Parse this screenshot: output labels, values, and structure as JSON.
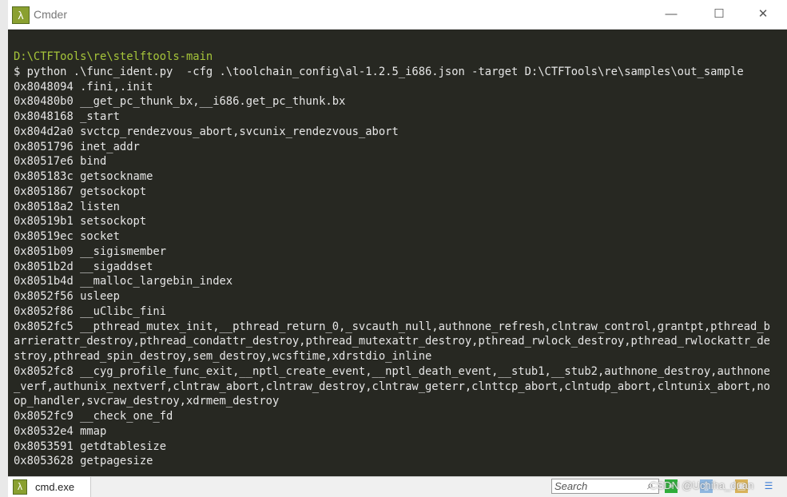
{
  "window": {
    "title": "Cmder",
    "minimize": "—",
    "maximize": "☐",
    "close": "✕"
  },
  "terminal": {
    "path": "D:\\CTFTools\\re\\stelftools-main",
    "lines": [
      "$ python .\\func_ident.py  -cfg .\\toolchain_config\\al-1.2.5_i686.json -target D:\\CTFTools\\re\\samples\\out_sample",
      "0x8048094 .fini,.init",
      "0x80480b0 __get_pc_thunk_bx,__i686.get_pc_thunk.bx",
      "0x8048168 _start",
      "0x804d2a0 svctcp_rendezvous_abort,svcunix_rendezvous_abort",
      "0x8051796 inet_addr",
      "0x80517e6 bind",
      "0x805183c getsockname",
      "0x8051867 getsockopt",
      "0x80518a2 listen",
      "0x80519b1 setsockopt",
      "0x80519ec socket",
      "0x8051b09 __sigismember",
      "0x8051b2d __sigaddset",
      "0x8051b4d __malloc_largebin_index",
      "0x8052f56 usleep",
      "0x8052f86 __uClibc_fini",
      "0x8052fc5 __pthread_mutex_init,__pthread_return_0,_svcauth_null,authnone_refresh,clntraw_control,grantpt,pthread_b",
      "arrierattr_destroy,pthread_condattr_destroy,pthread_mutexattr_destroy,pthread_rwlock_destroy,pthread_rwlockattr_de",
      "stroy,pthread_spin_destroy,sem_destroy,wcsftime,xdrstdio_inline",
      "0x8052fc8 __cyg_profile_func_exit,__nptl_create_event,__nptl_death_event,__stub1,__stub2,authnone_destroy,authnone",
      "_verf,authunix_nextverf,clntraw_abort,clntraw_destroy,clntraw_geterr,clnttcp_abort,clntudp_abort,clntunix_abort,no",
      "op_handler,svcraw_destroy,xdrmem_destroy",
      "0x8052fc9 __check_one_fd",
      "0x80532e4 mmap",
      "0x8053591 getdtablesize",
      "0x8053628 getpagesize"
    ]
  },
  "statusbar": {
    "tab_label": "cmd.exe",
    "search_placeholder": "Search",
    "watermark": "CSDN @Uchiha_duan"
  },
  "colors": {
    "background": "#272822",
    "path": "#a6c53a",
    "text": "#e6e6e6",
    "accent": "#8aa030"
  }
}
